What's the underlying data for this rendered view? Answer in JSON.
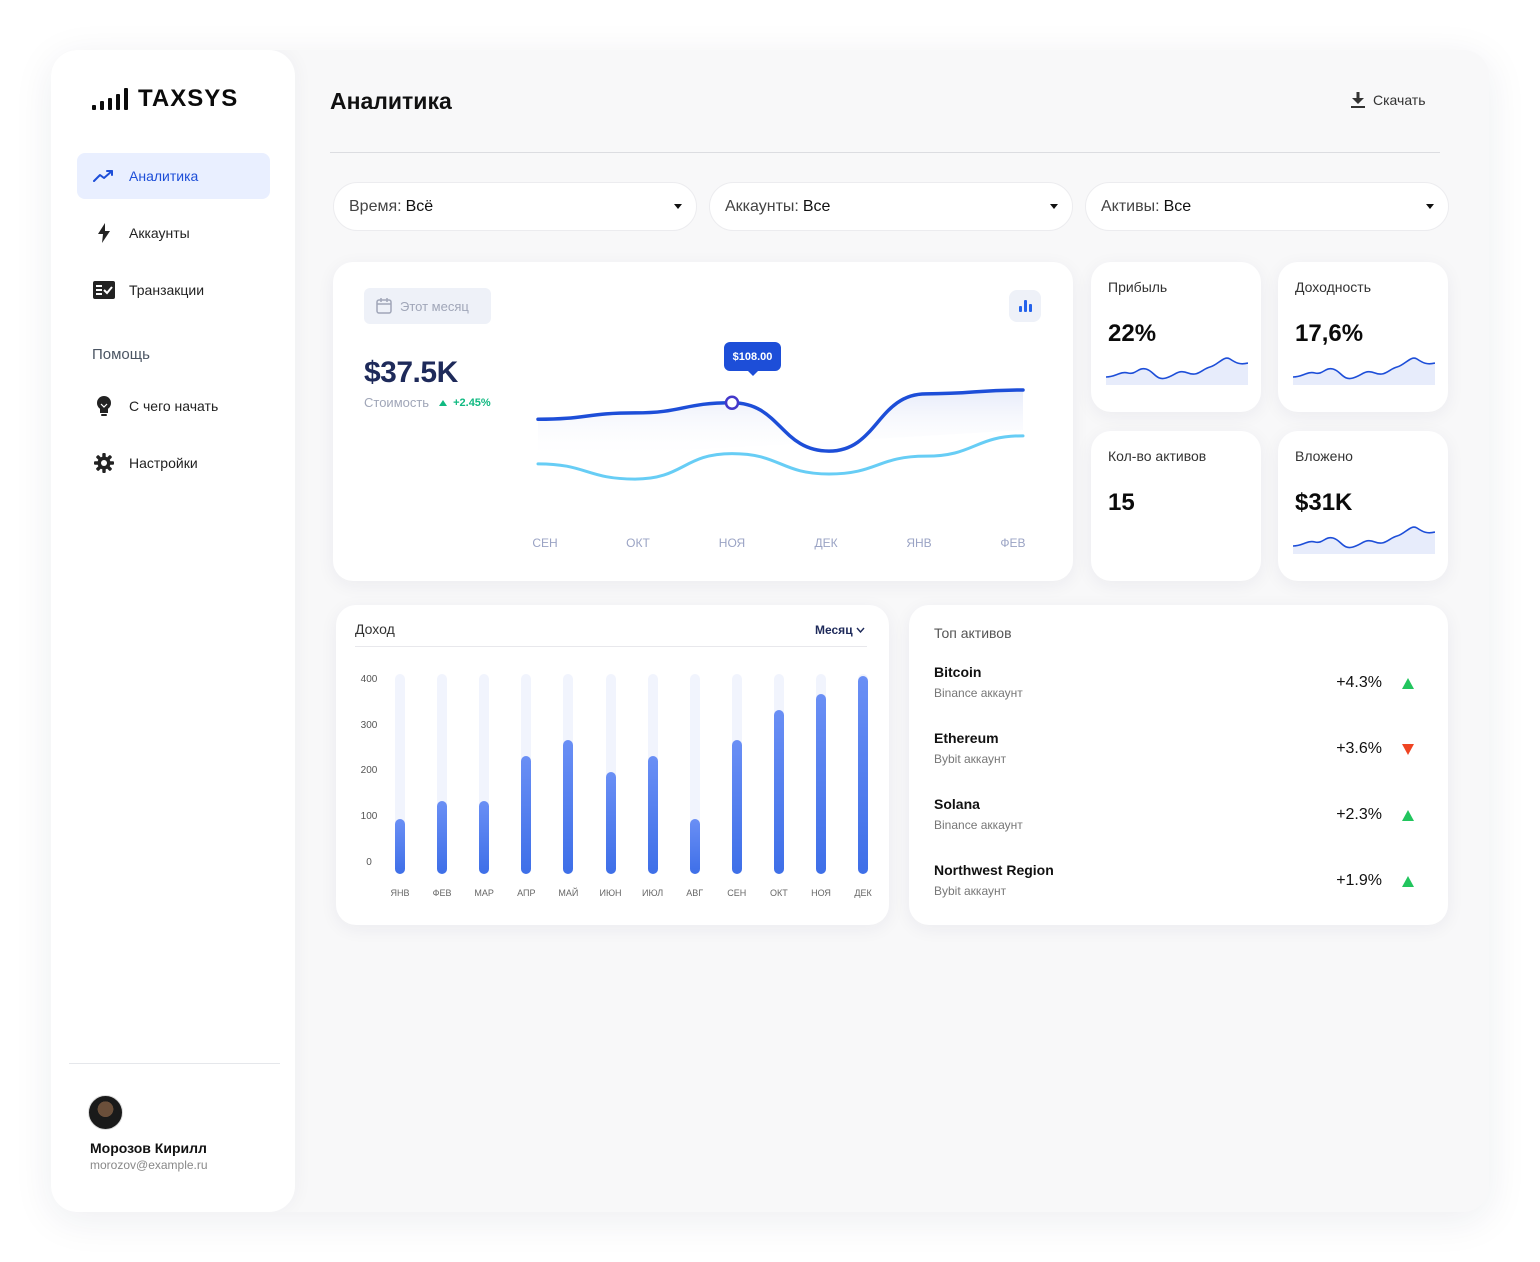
{
  "brand": {
    "name": "TAXSYS"
  },
  "sidebar": {
    "items": [
      {
        "label": "Аналитика",
        "icon": "trending-up-icon",
        "active": true
      },
      {
        "label": "Аккаунты",
        "icon": "lightning-icon"
      },
      {
        "label": "Транзакции",
        "icon": "checklist-icon"
      }
    ],
    "help_label": "Помощь",
    "help_items": [
      {
        "label": "С чего начать",
        "icon": "lightbulb-icon"
      },
      {
        "label": "Настройки",
        "icon": "gear-icon"
      }
    ],
    "user": {
      "name": "Морозов Кирилл",
      "email": "morozov@example.ru"
    }
  },
  "header": {
    "title": "Аналитика",
    "download_label": "Скачать"
  },
  "filters": [
    {
      "label": "Время:",
      "value": "Всё"
    },
    {
      "label": "Аккаунты:",
      "value": "Все"
    },
    {
      "label": "Активы:",
      "value": "Все"
    }
  ],
  "value_card": {
    "date_chip": "Этот месяц",
    "value": "$37.5K",
    "value_caption": "Стоимость",
    "change": "+2.45%",
    "tooltip": "$108.00",
    "months": [
      "СЕН",
      "ОКТ",
      "НОЯ",
      "ДЕК",
      "ЯНВ",
      "ФЕВ"
    ]
  },
  "stats": [
    {
      "label": "Прибыль",
      "value": "22%",
      "sparkline": true
    },
    {
      "label": "Доходность",
      "value": "17,6%",
      "sparkline": true
    },
    {
      "label": "Кол-во активов",
      "value": "15",
      "sparkline": false
    },
    {
      "label": "Вложено",
      "value": "$31K",
      "sparkline": true
    }
  ],
  "income": {
    "title": "Доход",
    "period": "Месяц"
  },
  "top_assets": {
    "title": "Топ активов",
    "items": [
      {
        "name": "Bitcoin",
        "account": "Binance аккаунт",
        "change": "+4.3%",
        "trend": "up"
      },
      {
        "name": "Ethereum",
        "account": "Bybit аккаунт",
        "change": "+3.6%",
        "trend": "down"
      },
      {
        "name": "Solana",
        "account": "Binance аккаунт",
        "change": "+2.3%",
        "trend": "up"
      },
      {
        "name": "Northwest Region",
        "account": "Bybit аккаунт",
        "change": "+1.9%",
        "trend": "up"
      }
    ]
  },
  "colors": {
    "accent": "#2563eb",
    "active_bg": "#e9efff",
    "up": "#22c55e",
    "down": "#ef4422",
    "line_primary": "#1d4ed8",
    "line_secondary": "#67cdf5"
  },
  "chart_data": [
    {
      "type": "line",
      "categories": [
        "СЕН",
        "ОКТ",
        "НОЯ",
        "ДЕК",
        "ЯНВ",
        "ФЕВ"
      ],
      "series": [
        {
          "values": [
            95,
            100,
            108,
            70,
            115,
            118
          ]
        },
        {
          "values": [
            60,
            48,
            68,
            52,
            66,
            82
          ]
        }
      ],
      "ylim": [
        30,
        140
      ]
    },
    {
      "type": "bar",
      "title": "Доход",
      "categories": [
        "ЯНВ",
        "ФЕВ",
        "МАР",
        "АПР",
        "МАЙ",
        "ИЮН",
        "ИЮЛ",
        "АВГ",
        "СЕН",
        "ОКТ",
        "НОЯ",
        "ДЕК"
      ],
      "values": [
        120,
        160,
        160,
        260,
        295,
        225,
        260,
        120,
        295,
        360,
        395,
        435
      ],
      "yticks": [
        "400",
        "300",
        "200",
        "100",
        "0"
      ],
      "ylim": [
        0,
        440
      ]
    }
  ]
}
